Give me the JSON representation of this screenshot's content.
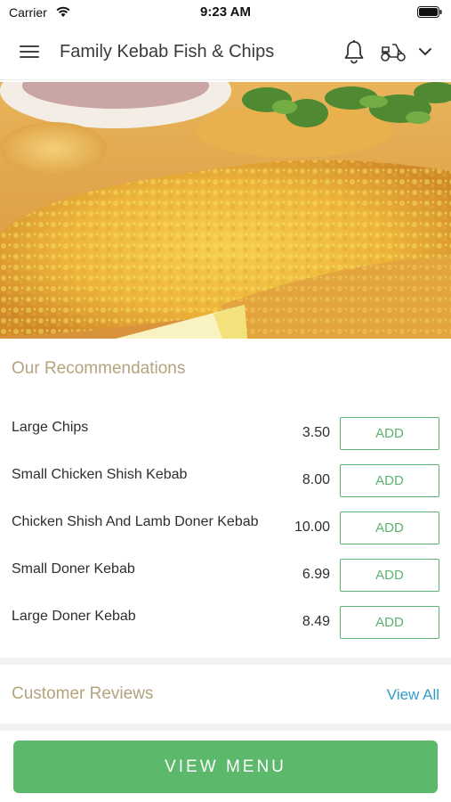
{
  "status_bar": {
    "carrier": "Carrier",
    "time": "9:23 AM"
  },
  "header": {
    "title": "Family Kebab Fish & Chips",
    "icons": [
      "menu-icon",
      "bell-icon",
      "delivery-scooter-icon",
      "chevron-down-icon"
    ]
  },
  "hero": {
    "image": "fried-fish-photo"
  },
  "recommendations": {
    "title": "Our Recommendations",
    "items": [
      {
        "name": "Large Chips",
        "price": "3.50",
        "button": "ADD"
      },
      {
        "name": "Small Chicken Shish Kebab",
        "price": "8.00",
        "button": "ADD"
      },
      {
        "name": "Chicken Shish And Lamb Doner Kebab",
        "price": "10.00",
        "button": "ADD"
      },
      {
        "name": "Small Doner Kebab",
        "price": "6.99",
        "button": "ADD"
      },
      {
        "name": "Large Doner Kebab",
        "price": "8.49",
        "button": "ADD"
      }
    ]
  },
  "reviews": {
    "title": "Customer Reviews",
    "view_all": "View All"
  },
  "bottom": {
    "view_menu": "VIEW MENU"
  },
  "colors": {
    "accent_green": "#5cb86b",
    "section_title": "#b3a47e",
    "link_blue": "#2e9cc9"
  }
}
